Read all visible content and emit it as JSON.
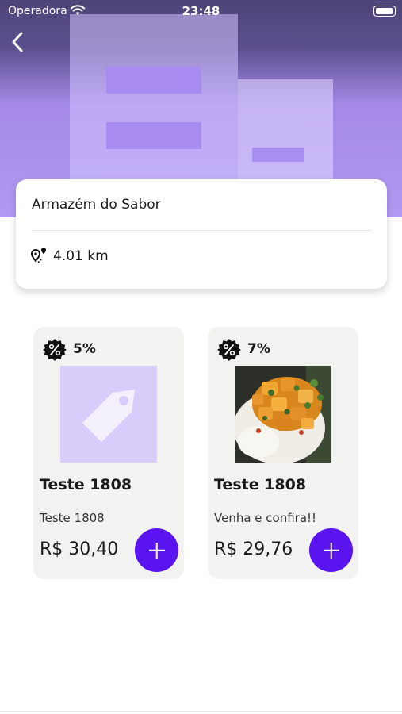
{
  "status_bar": {
    "carrier": "Operadora",
    "time": "23:48"
  },
  "store": {
    "name": "Armazém do Sabor",
    "distance": "4.01 km"
  },
  "products": [
    {
      "discount": "5%",
      "title": "Teste 1808",
      "description": "Teste 1808",
      "price": "R$ 30,40",
      "image": "tag-placeholder"
    },
    {
      "discount": "7%",
      "title": "Teste 1808",
      "description": "Venha e confira!!",
      "price": "R$ 29,76",
      "image": "food-photo"
    }
  ],
  "colors": {
    "accent": "#5a14f0",
    "header_top": "#4d4477",
    "header_bottom": "#b29af3",
    "card_bg": "#f2f2f0"
  },
  "icons": [
    "wifi-icon",
    "battery-icon",
    "back-arrow-icon",
    "location-pin-icon",
    "discount-badge-icon",
    "plus-icon"
  ]
}
